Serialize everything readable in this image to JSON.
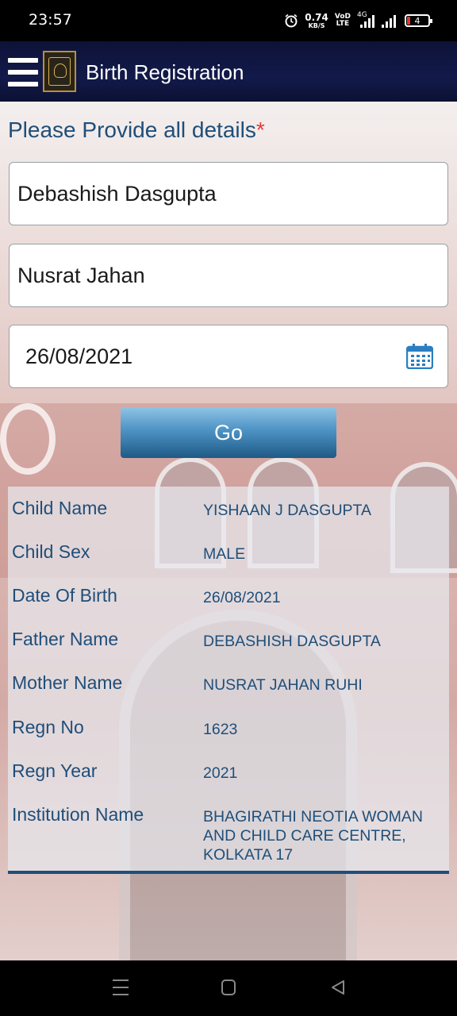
{
  "status_bar": {
    "time": "23:57",
    "speed_value": "0.74",
    "speed_unit": "KB/S",
    "volte_top": "VoD",
    "volte_bottom": "LTE",
    "network": "4G",
    "battery": "4"
  },
  "app_bar": {
    "title": "Birth Registration"
  },
  "form": {
    "heading": "Please Provide all details",
    "required_mark": "*",
    "father_name_value": "Debashish Dasgupta",
    "mother_name_value": "Nusrat Jahan",
    "dob_value": "26/08/2021",
    "go_label": "Go"
  },
  "details": [
    {
      "label": "Child Name",
      "value": "YISHAAN J DASGUPTA"
    },
    {
      "label": "Child Sex",
      "value": "MALE"
    },
    {
      "label": "Date Of Birth",
      "value": "26/08/2021"
    },
    {
      "label": "Father Name",
      "value": "DEBASHISH DASGUPTA"
    },
    {
      "label": "Mother Name",
      "value": "NUSRAT JAHAN RUHI"
    },
    {
      "label": "Regn No",
      "value": "1623"
    },
    {
      "label": "Regn Year",
      "value": "2021"
    },
    {
      "label": "Institution Name",
      "value": "BHAGIRATHI NEOTIA WOMAN AND CHILD CARE CENTRE, KOLKATA 17"
    }
  ],
  "colors": {
    "app_bar": "#0d1238",
    "label_text": "#1f4e79",
    "required": "#e53935",
    "go_button": "#1f5a86"
  },
  "icons": {
    "menu": "hamburger-icon",
    "logo": "corporation-logo",
    "calendar": "calendar-icon"
  }
}
